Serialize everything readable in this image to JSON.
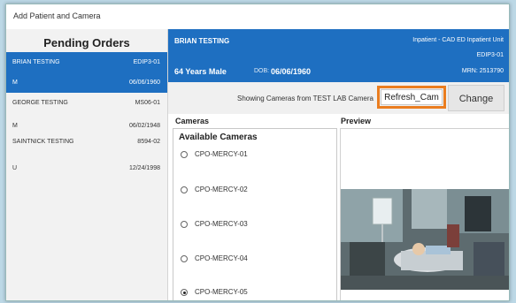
{
  "window": {
    "title": "Add Patient and Camera"
  },
  "pending": {
    "title": "Pending Orders",
    "rows": [
      {
        "left": "BRIAN TESTING",
        "right": "EDIP3-01"
      },
      {
        "left": "M",
        "right": "06/06/1960"
      },
      {
        "left": "GEORGE TESTING",
        "right": "MS06-01"
      },
      {
        "left": "M",
        "right": "06/02/1948"
      },
      {
        "left": "SAINTNICK TESTING",
        "right": "8594-02"
      },
      {
        "left": "U",
        "right": "12/24/1998"
      }
    ]
  },
  "patient": {
    "name": "BRIAN TESTING",
    "location": "Inpatient - CAD ED Inpatient Unit",
    "order_id": "EDIP3-01",
    "age_sex": "64 Years  Male",
    "dob_label": "DOB:",
    "dob": "06/06/1960",
    "mrn": "MRN: 2513790"
  },
  "camera_bar": {
    "showing": "Showing Cameras from TEST LAB Camera",
    "refresh_label": "Refresh_Cam",
    "change_label": "Change"
  },
  "cameras": {
    "section_label": "Cameras",
    "available_label": "Available Cameras",
    "items": [
      {
        "label": "CPO-MERCY-01"
      },
      {
        "label": "CPO-MERCY-02"
      },
      {
        "label": "CPO-MERCY-03"
      },
      {
        "label": "CPO-MERCY-04"
      },
      {
        "label": "CPO-MERCY-05"
      }
    ],
    "selected": "CPO-MERCY-05"
  },
  "preview": {
    "label": "Preview"
  },
  "colors": {
    "header_blue": "#1e6fc1",
    "highlight_orange": "#ea7d1f"
  }
}
